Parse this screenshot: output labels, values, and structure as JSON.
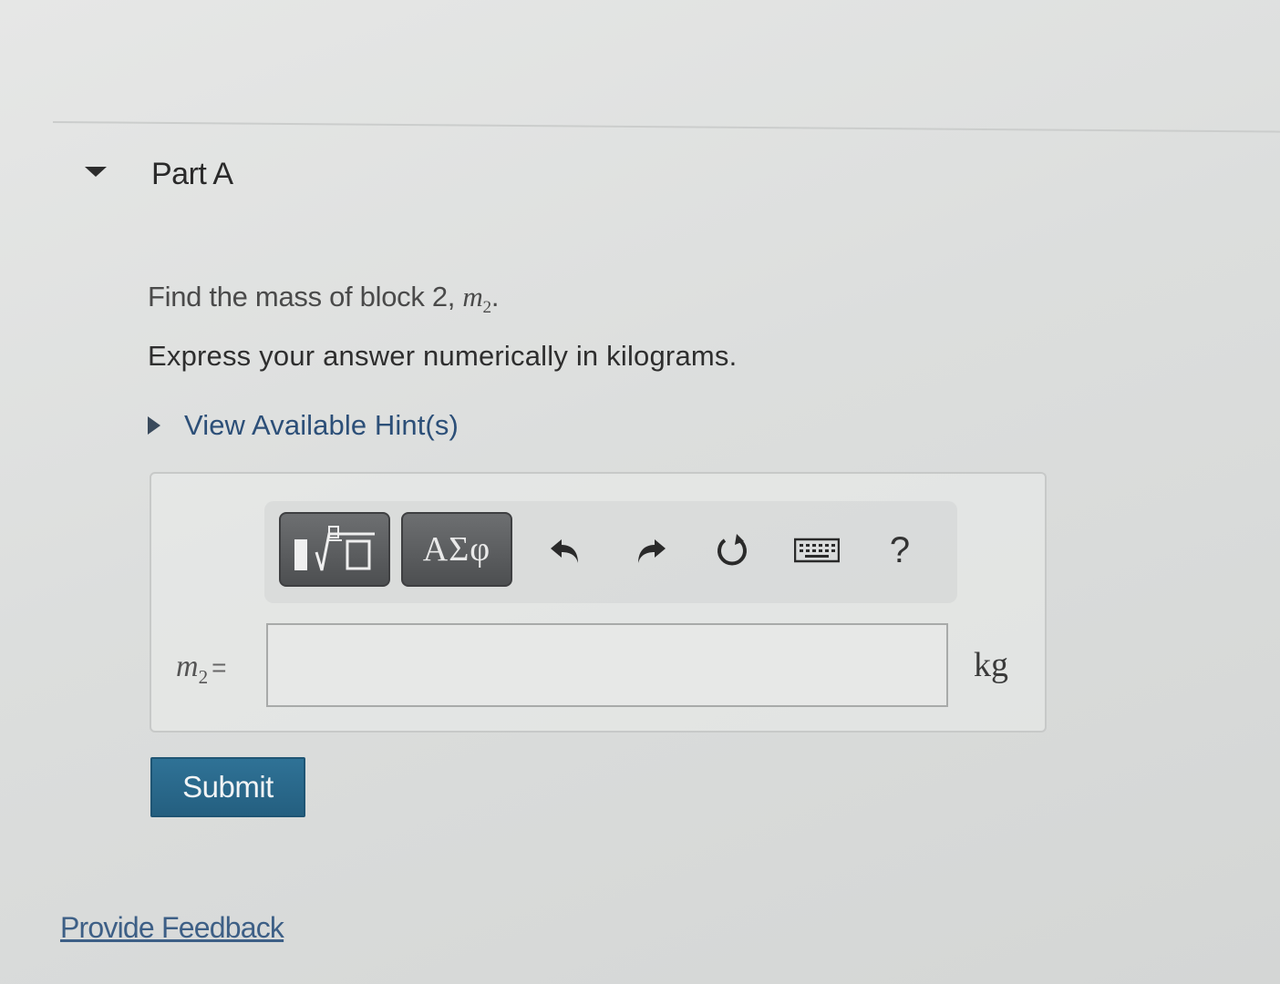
{
  "part": {
    "title": "Part A"
  },
  "question": {
    "text": "Find the mass of block 2, ",
    "variable": "m",
    "variable_subscript": "2",
    "end": ".",
    "instruction": "Express your answer numerically in kilograms."
  },
  "hint": {
    "label": "View Available Hint(s)"
  },
  "toolbar": {
    "symbols_label": "ΑΣφ",
    "help_label": "?"
  },
  "answer": {
    "variable": "m",
    "variable_subscript": "2",
    "equals": "=",
    "value": "",
    "unit": "kg"
  },
  "submit": {
    "label": "Submit"
  },
  "feedback": {
    "label": "Provide Feedback"
  }
}
